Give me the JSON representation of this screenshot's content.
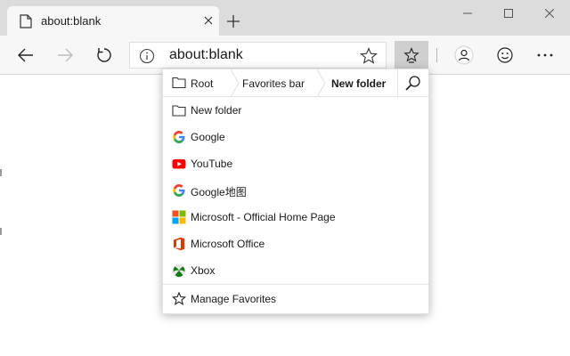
{
  "tab": {
    "title": "about:blank",
    "favicon": "page-icon"
  },
  "window_controls": [
    "minimize-icon",
    "maximize-icon",
    "close-icon"
  ],
  "toolbar": {
    "back": "back-arrow-icon",
    "forward": "forward-arrow-icon",
    "refresh": "refresh-icon",
    "address": "about:blank",
    "favorite_star": "star-outline-icon",
    "favorites_hub": "favorites-hub-icon",
    "profile": "person-icon",
    "feedback": "smiley-icon",
    "more": "more-icon"
  },
  "flyout": {
    "breadcrumbs": [
      {
        "label": "Root"
      },
      {
        "label": "Favorites bar"
      },
      {
        "label": "New folder"
      }
    ],
    "items": [
      {
        "label": "New folder",
        "icon": "folder-icon"
      },
      {
        "label": "Google",
        "icon": "google-icon"
      },
      {
        "label": "YouTube",
        "icon": "youtube-icon"
      },
      {
        "label": "Google地图",
        "icon": "google-icon"
      },
      {
        "label": "Microsoft - Official Home Page",
        "icon": "microsoft-icon"
      },
      {
        "label": "Microsoft Office",
        "icon": "office-icon"
      },
      {
        "label": "Xbox",
        "icon": "xbox-icon"
      }
    ],
    "footer": {
      "label": "Manage Favorites",
      "icon": "star-outline-icon"
    }
  },
  "colors": {
    "titlebar": "#dcdcdc",
    "toolbar": "#f7f7f7",
    "youtube_red": "#ff0000",
    "office_orange": "#d83b01",
    "xbox_green": "#107c10"
  }
}
